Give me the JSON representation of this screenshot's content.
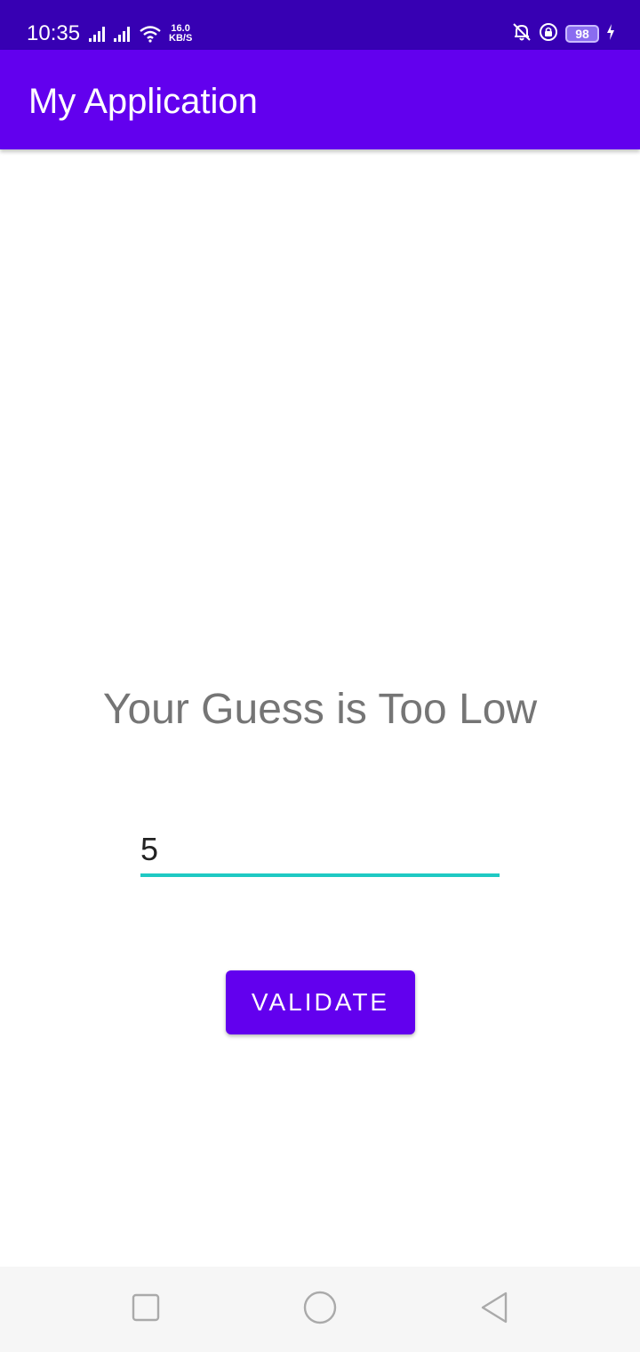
{
  "status_bar": {
    "time": "10:35",
    "net_speed_value": "16.0",
    "net_speed_unit": "KB/S",
    "battery_level": "98"
  },
  "app_bar": {
    "title": "My Application"
  },
  "content": {
    "result_message": "Your Guess is Too Low",
    "guess_input": {
      "value": "5"
    },
    "validate_label": "VALIDATE"
  },
  "colors": {
    "status_bar": "#3700b3",
    "primary": "#6200ee",
    "accent": "#1fc9c3",
    "message_text": "#757575"
  },
  "icons": {
    "status_left": [
      "signal-icon",
      "signal-icon",
      "wifi-icon"
    ],
    "status_right": [
      "bell-muted-icon",
      "rotation-lock-icon",
      "battery-icon",
      "charging-icon"
    ],
    "navigation": [
      "recents-icon",
      "home-icon",
      "back-icon"
    ]
  }
}
